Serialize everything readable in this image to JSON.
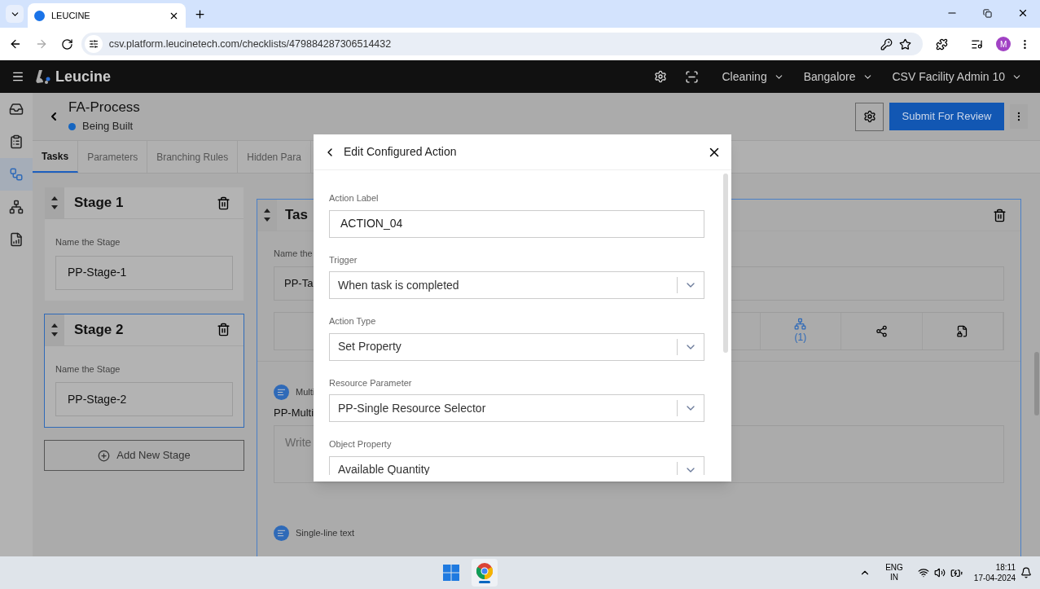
{
  "browser": {
    "tab_title": "LEUCINE",
    "url": "csv.platform.leucinetech.com/checklists/479884287306514432",
    "profile_initial": "M"
  },
  "app_header": {
    "brand": "Leucine",
    "menus": [
      "Cleaning",
      "Bangalore",
      "CSV Facility Admin 10"
    ]
  },
  "sidebar": {
    "items": [
      {
        "selected": false
      },
      {
        "selected": false
      },
      {
        "selected": true
      },
      {
        "selected": false
      },
      {
        "selected": false
      }
    ]
  },
  "process": {
    "title": "FA-Process",
    "status": {
      "label": "Being Built",
      "color": "#1565c0"
    },
    "submit_label": "Submit For Review"
  },
  "tabs": [
    {
      "label": "Tasks",
      "selected": true
    },
    {
      "label": "Parameters",
      "selected": false
    },
    {
      "label": "Branching Rules",
      "selected": false
    },
    {
      "label": "Hidden Para",
      "selected": false
    }
  ],
  "stages": [
    {
      "title": "Stage 1",
      "field_label": "Name the Stage",
      "value": "PP-Stage-1",
      "selected": false
    },
    {
      "title": "Stage 2",
      "field_label": "Name the Stage",
      "value": "PP-Stage-2",
      "selected": true
    }
  ],
  "add_stage_label": "Add New Stage",
  "task_card": {
    "title": "Tas",
    "name_label": "Name the",
    "name_value": "PP-Ta",
    "branching_count": "(1)",
    "parameters": [
      {
        "label": "Multi",
        "name": "PP-Multi",
        "placeholder": "Write"
      },
      {
        "label": "Single-line text"
      }
    ]
  },
  "modal": {
    "title": "Edit Configured Action",
    "fields": [
      {
        "label": "Action Label",
        "kind": "text",
        "value": "ACTION_04"
      },
      {
        "label": "Trigger",
        "kind": "select",
        "value": "When task is completed"
      },
      {
        "label": "Action Type",
        "kind": "select",
        "value": "Set Property"
      },
      {
        "label": "Resource Parameter",
        "kind": "select",
        "value": "PP-Single Resource Selector"
      },
      {
        "label": "Object Property",
        "kind": "select",
        "value": "Available Quantity"
      }
    ]
  },
  "taskbar": {
    "language": "ENG",
    "region": "IN",
    "time": "18:11",
    "date": "17-04-2024"
  }
}
